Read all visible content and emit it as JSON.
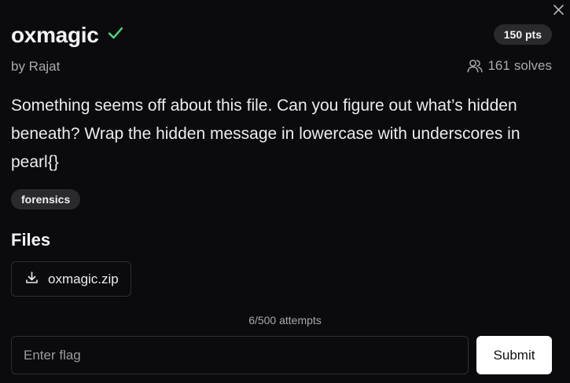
{
  "challenge": {
    "title": "oxmagic",
    "points": "150 pts",
    "author": "by Rajat",
    "solves_count": "161",
    "solves_label": "solves",
    "description": "Something seems off about this file. Can you figure out what’s hidden beneath? Wrap the hidden message in lowercase with underscores in pearl{}",
    "tag": "forensics",
    "solved": true
  },
  "files": {
    "heading": "Files",
    "items": [
      {
        "name": "oxmagic.zip",
        "icon": "download-icon"
      }
    ]
  },
  "attempts": "6/500 attempts",
  "flag_form": {
    "value": "",
    "placeholder": "Enter flag",
    "submit_label": "Submit"
  },
  "icons": {
    "close": "close-icon",
    "solved": "check-icon",
    "solves": "users-icon"
  },
  "colors": {
    "background": "#0b0b0d",
    "check_green": "#4ade80",
    "badge_bg": "#2a2a2d",
    "submit_bg": "#ffffff"
  }
}
